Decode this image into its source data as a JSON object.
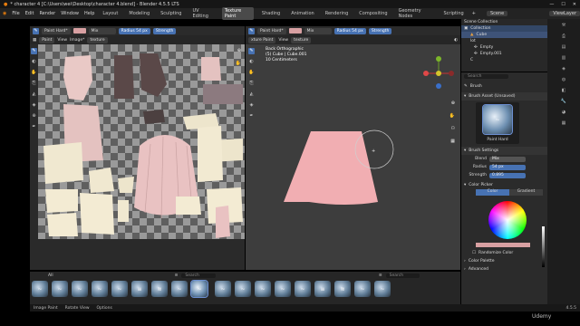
{
  "title_bar": {
    "title": "* character 4 [C:\\Users\\wei\\Desktop\\character 4.blend] - Blender 4.5.5 LTS"
  },
  "menu": {
    "items": [
      "File",
      "Edit",
      "Render",
      "Window",
      "Help"
    ]
  },
  "workspaces": [
    "Layout",
    "Modeling",
    "Sculpting",
    "UV Editing",
    "Texture Paint",
    "Shading",
    "Animation",
    "Rendering",
    "Compositing",
    "Geometry Nodes",
    "Scripting"
  ],
  "active_workspace": "Texture Paint",
  "scene": {
    "label": "Scene",
    "view_layer": "ViewLayer"
  },
  "image_editor": {
    "mode": "Paint",
    "mode_suffix": "Hard*",
    "color_hex": "#d8a0a2",
    "blend": "Mix",
    "radius_label": "Radius",
    "radius_value": "54 px",
    "strength_label": "Strength",
    "view_menu": "View",
    "image_menu": "Image*",
    "image_name": "texture"
  },
  "viewport": {
    "mode_label": "xture Paint",
    "view_menu": "View",
    "paint_mode": "Paint",
    "paint_suffix": "Hard*",
    "blend": "Mix",
    "radius_label": "Radius",
    "radius_value": "54 px",
    "strength_label": "Strength",
    "texture_label": "texture",
    "overlay_line1": "Back Orthographic",
    "overlay_line2": "(5) Cube | Cube.001",
    "overlay_line3": "10 Centimeters"
  },
  "asset_shelf": {
    "all_label": "All",
    "search_placeholder": "Search",
    "brush_glyphs": [
      "~",
      "~",
      "~",
      "~",
      "~",
      "≡",
      "≋",
      "~",
      "~",
      "~",
      "~",
      "~",
      "~",
      "~",
      "≡",
      "≋",
      "~",
      "~"
    ]
  },
  "status_bar": {
    "items": [
      "Image Paint",
      "Rotate View",
      "Options"
    ],
    "version": "4.5.5"
  },
  "outliner": {
    "title": "Scene Collection",
    "collection": "Collection",
    "items": [
      "Cube",
      "lot",
      "Empty",
      "Empty.001",
      "C"
    ]
  },
  "properties": {
    "search_placeholder": "Search",
    "brush_tab": "Brush",
    "brush_asset": "Brush Asset (Unsaved)",
    "brush_name": "Paint Hard",
    "brush_settings": "Brush Settings",
    "blend_label": "Blend",
    "blend_value": "Mix",
    "radius_label": "Radius",
    "radius_value": "54 px",
    "strength_label": "Strength",
    "strength_value": "0.895",
    "color_picker": "Color Picker",
    "color_tab": "Color",
    "gradient_tab": "Gradient",
    "randomize": "Randomize Color",
    "palette": "Color Palette",
    "advanced": "Advanced"
  },
  "watermark": "Udemy"
}
